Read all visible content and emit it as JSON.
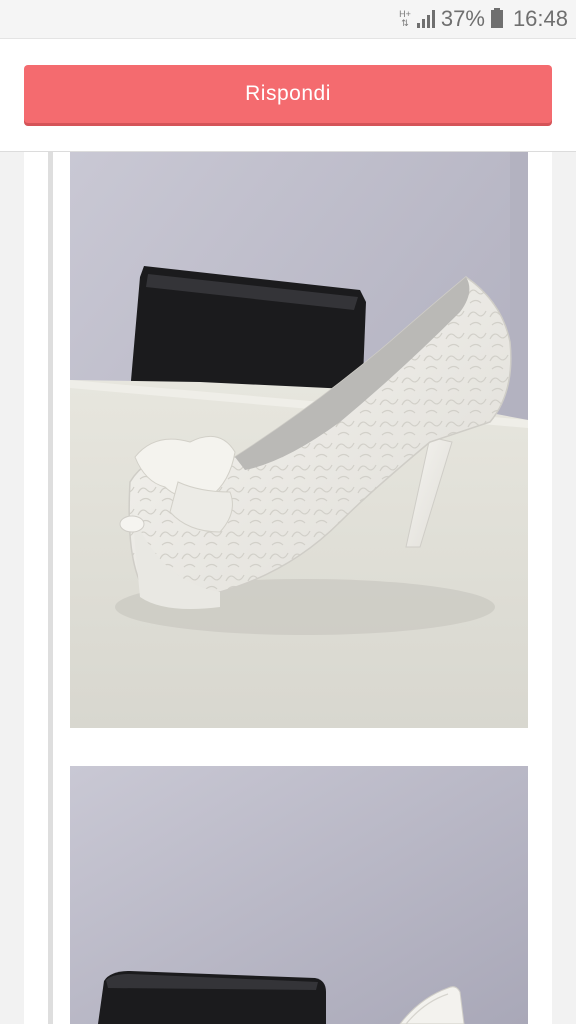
{
  "status_bar": {
    "network": "H+",
    "battery_percent": "37%",
    "time": "16:48"
  },
  "header": {
    "reply_label": "Rispondi"
  },
  "colors": {
    "accent": "#f46b6f",
    "background": "#f2f2f2"
  },
  "content": {
    "photos": [
      {
        "icon": "white-lace-peep-toe-heel-photo"
      },
      {
        "icon": "white-lace-heel-photo-partial"
      }
    ]
  }
}
